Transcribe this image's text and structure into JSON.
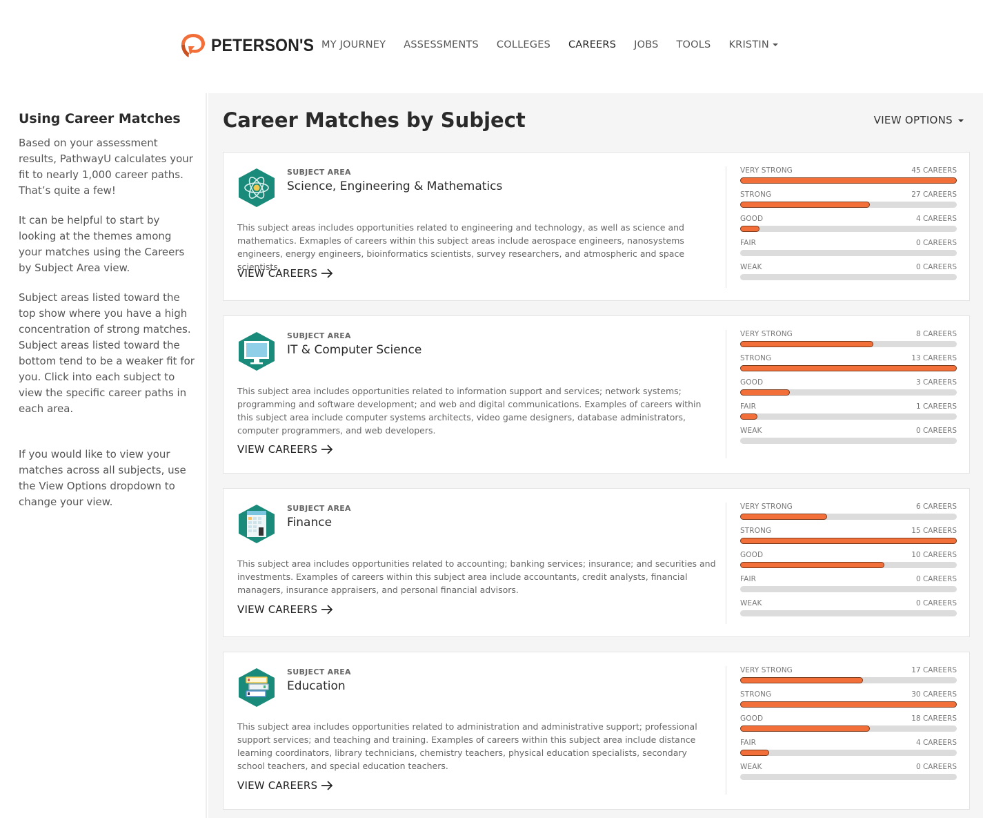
{
  "nav": {
    "brand": "PETERSON'S",
    "links": [
      {
        "label": "MY JOURNEY",
        "active": false
      },
      {
        "label": "ASSESSMENTS",
        "active": false
      },
      {
        "label": "COLLEGES",
        "active": false
      },
      {
        "label": "CAREERS",
        "active": true
      },
      {
        "label": "JOBS",
        "active": false
      },
      {
        "label": "TOOLS",
        "active": false
      }
    ],
    "user": "KRISTIN",
    "brand_color": "#f26f3a"
  },
  "sidebar": {
    "title": "Using Career Matches",
    "paragraphs": [
      "Based on your assessment results, PathwayU calculates your fit to nearly 1,000 career paths. That’s quite a few!",
      "It can be helpful to start by looking at the themes among your matches using the Careers by Subject Area view.",
      "Subject areas listed toward the top show where you have a high concentration of strong matches. Subject areas listed toward the bottom tend to be a weaker fit for you. Click into each subject to view the specific career paths in each area.",
      "If you would like to view your matches across all subjects, use the View Options dropdown to change your view."
    ]
  },
  "main": {
    "title": "Career Matches by Subject",
    "view_options": "VIEW OPTIONS",
    "subject_label": "SUBJECT AREA",
    "view_careers_label": "VIEW CAREERS",
    "accent_color": "#f26f3a",
    "icon_color": "#1a8a7a",
    "cards": [
      {
        "icon": "atom-icon",
        "name": "Science, Engineering & Mathematics",
        "description": "This subject areas includes opportunities related to engineering and technology, as well as science and mathematics. Exmaples of careers within this subject areas include aerospace engineers, nanosystems engineers, energy engineers, bioinformatics scientists, survey researchers, and atmospheric and space scientists.",
        "matches": [
          {
            "level": "VERY STRONG",
            "count": 45,
            "count_label": "45 CAREERS"
          },
          {
            "level": "STRONG",
            "count": 27,
            "count_label": "27 CAREERS"
          },
          {
            "level": "GOOD",
            "count": 4,
            "count_label": "4 CAREERS"
          },
          {
            "level": "FAIR",
            "count": 0,
            "count_label": "0 CAREERS"
          },
          {
            "level": "WEAK",
            "count": 0,
            "count_label": "0 CAREERS"
          }
        ]
      },
      {
        "icon": "computer-monitor-icon",
        "name": "IT & Computer Science",
        "description": "This subject area includes opportunities related to information support and services; network systems; programming and software development; and web and digital communications. Examples of careers within this subject area include computer systems architects, video game designers, database administrators, computer programmers, and web developers.",
        "matches": [
          {
            "level": "VERY STRONG",
            "count": 8,
            "count_label": "8 CAREERS"
          },
          {
            "level": "STRONG",
            "count": 13,
            "count_label": "13 CAREERS"
          },
          {
            "level": "GOOD",
            "count": 3,
            "count_label": "3 CAREERS"
          },
          {
            "level": "FAIR",
            "count": 1,
            "count_label": "1 CAREERS"
          },
          {
            "level": "WEAK",
            "count": 0,
            "count_label": "0 CAREERS"
          }
        ]
      },
      {
        "icon": "calculator-icon",
        "name": "Finance",
        "description": "This subject area includes opportunities related to accounting; banking services; insurance; and securities and investments. Examples of careers within this subject area include accountants, credit analysts, financial managers, insurance appraisers, and personal financial advisors.",
        "matches": [
          {
            "level": "VERY STRONG",
            "count": 6,
            "count_label": "6 CAREERS"
          },
          {
            "level": "STRONG",
            "count": 15,
            "count_label": "15 CAREERS"
          },
          {
            "level": "GOOD",
            "count": 10,
            "count_label": "10 CAREERS"
          },
          {
            "level": "FAIR",
            "count": 0,
            "count_label": "0 CAREERS"
          },
          {
            "level": "WEAK",
            "count": 0,
            "count_label": "0 CAREERS"
          }
        ]
      },
      {
        "icon": "books-icon",
        "name": "Education",
        "description": "This subject area includes opportunities related to administration and administrative support; professional support services; and teaching and training. Examples of careers within this subject area include distance learning coordinators, library technicians, chemistry teachers, physical education specialists, secondary school teachers, and special education teachers.",
        "matches": [
          {
            "level": "VERY STRONG",
            "count": 17,
            "count_label": "17 CAREERS"
          },
          {
            "level": "STRONG",
            "count": 30,
            "count_label": "30 CAREERS"
          },
          {
            "level": "GOOD",
            "count": 18,
            "count_label": "18 CAREERS"
          },
          {
            "level": "FAIR",
            "count": 4,
            "count_label": "4 CAREERS"
          },
          {
            "level": "WEAK",
            "count": 0,
            "count_label": "0 CAREERS"
          }
        ]
      }
    ]
  }
}
